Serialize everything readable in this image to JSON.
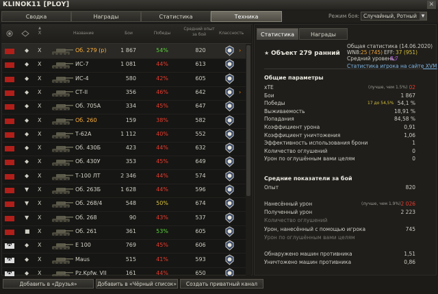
{
  "window": {
    "title": "KLINOK11 [PLOY]"
  },
  "tabs": [
    "Сводка",
    "Награды",
    "Статистика",
    "Техника"
  ],
  "mode": {
    "label": "Режим боя:",
    "value": "Случайный, Ротный"
  },
  "columns": {
    "name": "Название",
    "battles": "Бои",
    "wins": "Победы",
    "avg_exp": "Средний опыт за бой",
    "mastery": "Классность"
  },
  "tanks": [
    {
      "nation": "ussr",
      "cls": "◆",
      "tier": "X",
      "name": "Об. 279 (р)",
      "battles": "1 867",
      "wr": "54%",
      "exp": "820",
      "gold": true,
      "selected": true
    },
    {
      "nation": "ussr",
      "cls": "◆",
      "tier": "X",
      "name": "ИС-7",
      "battles": "1 081",
      "wr": "44%",
      "exp": "613"
    },
    {
      "nation": "ussr",
      "cls": "◆",
      "tier": "X",
      "name": "ИС-4",
      "battles": "580",
      "wr": "42%",
      "exp": "605"
    },
    {
      "nation": "ussr",
      "cls": "◆",
      "tier": "X",
      "name": "СТ-II",
      "battles": "356",
      "wr": "46%",
      "exp": "642"
    },
    {
      "nation": "ussr",
      "cls": "◆",
      "tier": "X",
      "name": "Об. 705А",
      "battles": "334",
      "wr": "45%",
      "exp": "647"
    },
    {
      "nation": "ussr",
      "cls": "◆",
      "tier": "X",
      "name": "Об. 260",
      "battles": "159",
      "wr": "38%",
      "exp": "582",
      "gold": true
    },
    {
      "nation": "ussr",
      "cls": "◆",
      "tier": "X",
      "name": "Т-62А",
      "battles": "1 112",
      "wr": "40%",
      "exp": "552"
    },
    {
      "nation": "ussr",
      "cls": "◆",
      "tier": "X",
      "name": "Об. 430Б",
      "battles": "423",
      "wr": "44%",
      "exp": "632"
    },
    {
      "nation": "ussr",
      "cls": "◆",
      "tier": "X",
      "name": "Об. 430У",
      "battles": "353",
      "wr": "45%",
      "exp": "649"
    },
    {
      "nation": "ussr",
      "cls": "◆",
      "tier": "X",
      "name": "Т-100 ЛТ",
      "battles": "2 346",
      "wr": "44%",
      "exp": "574"
    },
    {
      "nation": "ussr",
      "cls": "▼",
      "tier": "X",
      "name": "Об. 263Б",
      "battles": "1 628",
      "wr": "44%",
      "exp": "596"
    },
    {
      "nation": "ussr",
      "cls": "▼",
      "tier": "X",
      "name": "Об. 268/4",
      "battles": "548",
      "wr": "50%",
      "exp": "674"
    },
    {
      "nation": "ussr",
      "cls": "▼",
      "tier": "X",
      "name": "Об. 268",
      "battles": "90",
      "wr": "43%",
      "exp": "537"
    },
    {
      "nation": "ussr",
      "cls": "■",
      "tier": "X",
      "name": "Об. 261",
      "battles": "361",
      "wr": "53%",
      "exp": "605"
    },
    {
      "nation": "ger",
      "cls": "◆",
      "tier": "X",
      "name": "E 100",
      "battles": "769",
      "wr": "45%",
      "exp": "606"
    },
    {
      "nation": "ger",
      "cls": "◆",
      "tier": "X",
      "name": "Maus",
      "battles": "515",
      "wr": "41%",
      "exp": "593"
    },
    {
      "nation": "ger",
      "cls": "◆",
      "tier": "X",
      "name": "Pz.Kpfw. VII",
      "battles": "161",
      "wr": "44%",
      "exp": "650"
    }
  ],
  "right": {
    "tabs": [
      "Статистика",
      "Награды"
    ],
    "tank_name": "Объект 279 ранний",
    "overall_label": "Общая статистика (14.06.2020)",
    "wn8_label": "WN8:",
    "wn8_value": "25 (745)",
    "eff_label": "EFF:",
    "eff_value": "37 (951)",
    "avg_level_label": "Средний уровень:",
    "avg_level_value": "8,7",
    "xvm_link": "Статистика игрока на сайте XVM",
    "general_title": "Общие параметры",
    "general": [
      {
        "label": "xTE",
        "hint": "(лучше, чем 1.5%)",
        "value": "02",
        "red": true
      },
      {
        "label": "Бои",
        "value": "1 867"
      },
      {
        "label": "Победы",
        "hint": "17 до 54,5%",
        "value": "54,1 %",
        "hintYellow": true
      },
      {
        "label": "Выживаемость",
        "value": "18,91 %"
      },
      {
        "label": "Попадания",
        "value": "84,58 %"
      },
      {
        "label": "Коэффициент урона",
        "value": "0,91"
      },
      {
        "label": "Коэффициент уничтожения",
        "value": "1,06"
      },
      {
        "label": "Эффективность использования брони",
        "value": "1"
      },
      {
        "label": "Количество оглушений",
        "value": "0"
      },
      {
        "label": "Урон по оглушённым вами целям",
        "value": "0"
      }
    ],
    "avg_title": "Средние показатели за бой",
    "avg": [
      {
        "label": "Опыт",
        "value": "820"
      },
      {
        "label": "",
        "value": ""
      },
      {
        "label": "Нанесённый урон",
        "hint": "(лучше, чем 1.9%)",
        "value": "2 026",
        "red": true
      },
      {
        "label": "Полученный урон",
        "value": "2 223"
      },
      {
        "label": "Количество оглушений",
        "value": "",
        "dim": true
      },
      {
        "label": "Урон, нанесённый с помощью игрока",
        "value": "745"
      },
      {
        "label": "Урон по оглушённым вами целям",
        "value": "",
        "dim": true
      },
      {
        "label": "",
        "value": ""
      },
      {
        "label": "Обнаружено машин противника",
        "value": "1,51"
      },
      {
        "label": "Уничтожено машин противника",
        "value": "0,86"
      }
    ]
  },
  "buttons": {
    "friends": "Добавить в «Друзья»",
    "blacklist": "Добавить в «Чёрный список»",
    "private": "Создать приватный канал"
  }
}
